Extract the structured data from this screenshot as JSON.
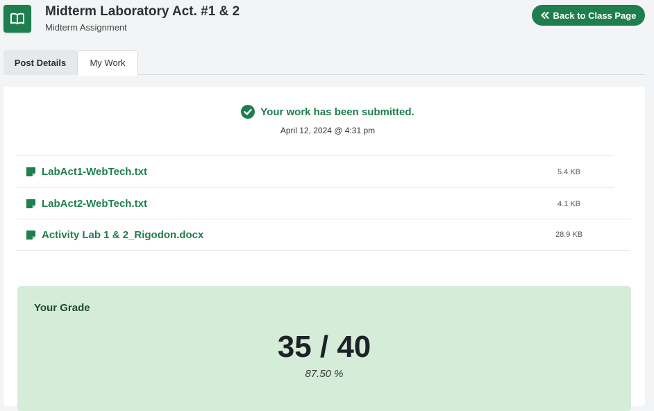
{
  "header": {
    "app_icon": "open-book-icon",
    "title": "Midterm Laboratory Act. #1 & 2",
    "subtitle": "Midterm Assignment",
    "back_button": {
      "icon": "double-chevron-left-icon",
      "label": "Back to Class Page"
    }
  },
  "tabs": [
    {
      "label": "Post Details",
      "active": false
    },
    {
      "label": "My Work",
      "active": true
    }
  ],
  "submission": {
    "status_icon": "check-circle-icon",
    "status": "Your work has been submitted.",
    "date": "April 12, 2024 @ 4:31 pm"
  },
  "files": [
    {
      "icon": "file-icon",
      "name": "LabAct1-WebTech.txt",
      "size": "5.4 KB"
    },
    {
      "icon": "file-icon",
      "name": "LabAct2-WebTech.txt",
      "size": "4.1 KB"
    },
    {
      "icon": "file-icon",
      "name": "Activity Lab 1 & 2_Rigodon.docx",
      "size": "28.9 KB"
    }
  ],
  "grade": {
    "label": "Your Grade",
    "score": "35 / 40",
    "percent": "87.50 %"
  },
  "colors": {
    "accent": "#1e7e4e",
    "grade_background": "#d5ecd9"
  }
}
